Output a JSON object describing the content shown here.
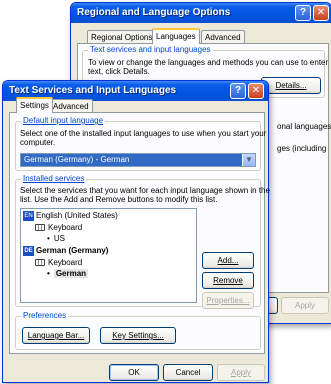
{
  "back_window": {
    "title": "Regional and Language Options",
    "tabs": [
      "Regional Options",
      "Languages",
      "Advanced"
    ],
    "group_title": "Text services and input languages",
    "group_text_1": "To view or change the languages and methods you can use to enter",
    "group_text_2": "text, click Details.",
    "details_button": "Details...",
    "peek_text_1": "onal languages,",
    "peek_text_2": "ges (including",
    "apply_button": "Apply"
  },
  "front_window": {
    "title": "Text Services and Input Languages",
    "tabs": [
      "Settings",
      "Advanced"
    ],
    "default_input": {
      "title": "Default input language",
      "desc_1": "Select one of the installed input languages to use when you start your",
      "desc_2": "computer.",
      "selected": "German (Germany) - German"
    },
    "installed": {
      "title": "Installed services",
      "desc_1": "Select the services that you want for each input language shown in the",
      "desc_2": "list. Use the Add and Remove buttons to modify this list.",
      "tree": [
        {
          "badge": "EN",
          "label": "English (United States)"
        },
        {
          "label": "Keyboard"
        },
        {
          "label": "US"
        },
        {
          "badge": "DE",
          "label": "German (Germany)"
        },
        {
          "label": "Keyboard"
        },
        {
          "label": "German"
        }
      ],
      "add_button": "Add...",
      "remove_button": "Remove",
      "properties_button": "Properties..."
    },
    "preferences": {
      "title": "Preferences",
      "language_bar_button": "Language Bar...",
      "key_settings_button": "Key Settings..."
    },
    "ok_button": "OK",
    "cancel_button": "Cancel",
    "apply_button": "Apply"
  }
}
